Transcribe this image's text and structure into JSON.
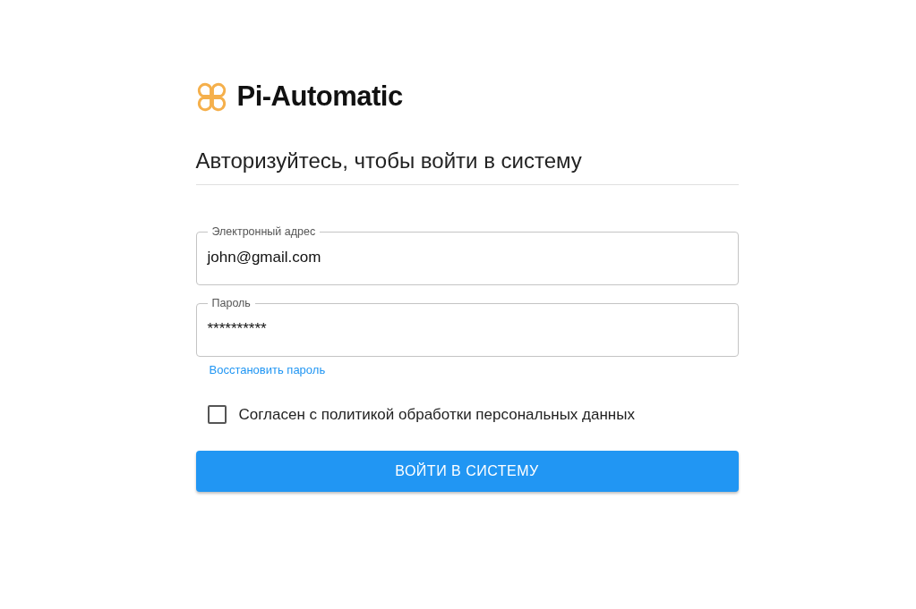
{
  "brand": {
    "name": "Pi-Automatic"
  },
  "heading": "Авторизуйтесь, чтобы войти в систему",
  "fields": [
    {
      "label": "Электронный адрес",
      "value": "john@gmail.com"
    },
    {
      "label": "Пароль",
      "value": "**********"
    }
  ],
  "forgot_link": "Восстановить пароль",
  "consent": {
    "label": "Согласен с политикой обработки персональных данных",
    "checked": false
  },
  "submit_button": "ВОЙТИ В СИСТЕМУ"
}
